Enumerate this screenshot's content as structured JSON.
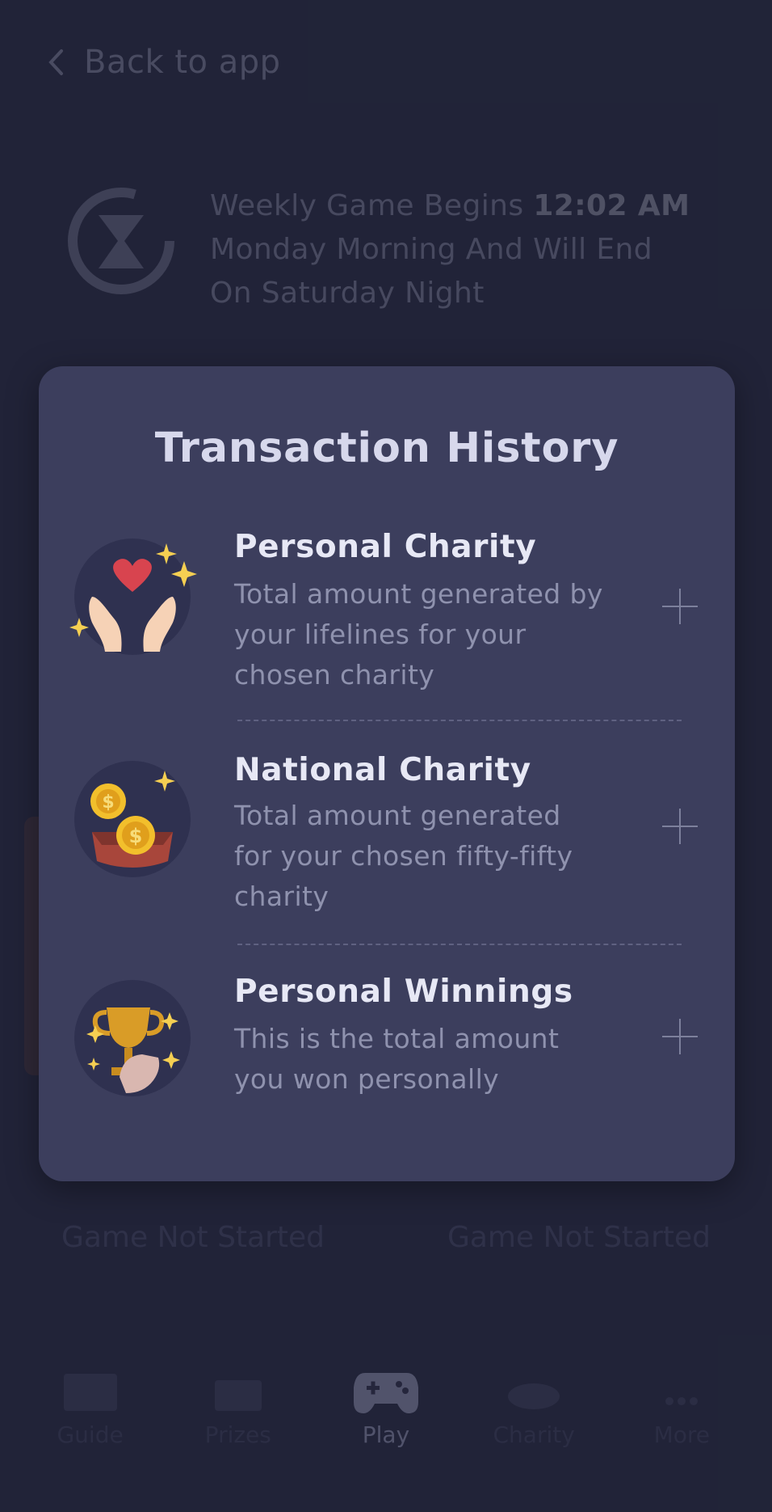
{
  "header": {
    "back_label": "Back to app"
  },
  "info": {
    "line_prefix": "Weekly Game Begins",
    "time": "12:02 AM",
    "line_rest1": "Monday Morning And Will End",
    "line_rest2": "On Saturday Night"
  },
  "status": {
    "left": "Game Not Started",
    "right": "Game Not Started"
  },
  "nav": [
    {
      "label": "Guide",
      "icon": "guide-icon"
    },
    {
      "label": "Prizes",
      "icon": "prizes-icon"
    },
    {
      "label": "Play",
      "icon": "gamepad-icon"
    },
    {
      "label": "Charity",
      "icon": "charity-icon"
    },
    {
      "label": "More",
      "icon": "more-icon"
    }
  ],
  "modal": {
    "title": "Transaction History",
    "items": [
      {
        "title": "Personal Charity",
        "desc1": "Total amount generated by",
        "desc2": "your lifelines for your",
        "desc3": "chosen  charity",
        "icon": "heart-hands-icon"
      },
      {
        "title": "National Charity",
        "desc1": "Total amount generated",
        "desc2": "for your chosen fifty-fifty",
        "desc3": "charity",
        "icon": "coin-donation-icon"
      },
      {
        "title": "Personal Winnings",
        "desc1": "This is the total amount",
        "desc2": "you won personally",
        "icon": "trophy-icon"
      }
    ]
  },
  "colors": {
    "background": "#24273c",
    "modal": "#3c3e5d",
    "title": "#d7d8ec",
    "desc": "#8f92ae"
  }
}
